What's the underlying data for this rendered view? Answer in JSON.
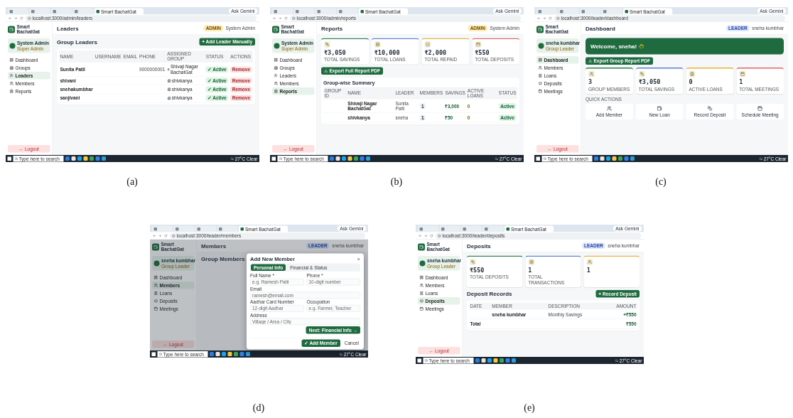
{
  "panels": [
    {
      "caption": "(a)",
      "browser": {
        "tabs": [
          {
            "selected": false
          },
          {
            "selected": false
          },
          {
            "selected": false
          },
          {
            "selected": false
          },
          {
            "title": "Smart BachatGat",
            "selected": true
          }
        ],
        "gemini": "Ask Gemini",
        "url": "localhost:3000/admin/leaders"
      },
      "sidebar": {
        "brand": "Smart BachatGat",
        "user": {
          "name": "System Admin",
          "role": "Super Admin"
        },
        "items": [
          {
            "label": "Dashboard",
            "kind": "dashboard",
            "selected": false
          },
          {
            "label": "Groups",
            "kind": "groups",
            "selected": false
          },
          {
            "label": "Leaders",
            "kind": "leaders",
            "selected": true
          },
          {
            "label": "Members",
            "kind": "members",
            "selected": false
          },
          {
            "label": "Reports",
            "kind": "reports",
            "selected": false
          }
        ],
        "logout": "← Logout"
      },
      "header": {
        "title": "Leaders",
        "badge": {
          "label": "ADMIN",
          "kind": "admin"
        },
        "user": "System Admin"
      },
      "blocks": [
        {
          "kind": "section-head",
          "title": "Group Leaders",
          "button": "+ Add Leader Manually"
        },
        {
          "kind": "table-card",
          "columns": [
            {
              "label": "NAME",
              "kind": "name"
            },
            {
              "label": "USERNAME",
              "kind": "muted"
            },
            {
              "label": "EMAIL",
              "kind": "muted"
            },
            {
              "label": "PHONE",
              "kind": "muted"
            },
            {
              "label": "ASSIGNED GROUP",
              "kind": "group"
            },
            {
              "label": "STATUS",
              "kind": "status"
            },
            {
              "label": "ACTIONS",
              "kind": "action"
            }
          ],
          "rows": [
            [
              "Sunita Patil",
              null,
              null,
              "9000000001",
              "Shivaji Nagar BachatGat",
              "✓ Active",
              "Remove"
            ],
            [
              "shivani",
              null,
              null,
              null,
              "shivkanya",
              "✓ Active",
              "Remove"
            ],
            [
              "snehakumbhar",
              null,
              null,
              null,
              "shivkanya",
              "✓ Active",
              "Remove"
            ],
            [
              "sanjivani",
              null,
              null,
              null,
              "shivkanya",
              "✓ Active",
              "Remove"
            ]
          ]
        }
      ],
      "taskbar": {
        "search": "Type here to search",
        "weather": "27°C Clear"
      }
    },
    {
      "caption": "(b)",
      "browser": {
        "tabs": [
          {
            "selected": false
          },
          {
            "selected": false
          },
          {
            "selected": false
          },
          {
            "selected": false
          },
          {
            "title": "Smart BachatGat",
            "selected": true
          }
        ],
        "gemini": "Ask Gemini",
        "url": "localhost:3000/admin/reports"
      },
      "sidebar": {
        "brand": "Smart BachatGat",
        "user": {
          "name": "System Admin",
          "role": "Super Admin"
        },
        "items": [
          {
            "label": "Dashboard",
            "kind": "dashboard",
            "selected": false
          },
          {
            "label": "Groups",
            "kind": "groups",
            "selected": false
          },
          {
            "label": "Leaders",
            "kind": "leaders",
            "selected": false
          },
          {
            "label": "Members",
            "kind": "members",
            "selected": false
          },
          {
            "label": "Reports",
            "kind": "reports",
            "selected": true
          }
        ],
        "logout": "← Logout"
      },
      "header": {
        "title": "Reports",
        "badge": {
          "label": "ADMIN",
          "kind": "admin"
        },
        "user": "System Admin"
      },
      "blocks": [
        {
          "kind": "stats",
          "items": [
            {
              "value": "₹3,050",
              "label": "TOTAL SAVINGS",
              "kind": "coins",
              "color": "#2e7d4f"
            },
            {
              "value": "₹10,000",
              "label": "TOTAL LOANS",
              "kind": "document",
              "color": "#5b7fd6"
            },
            {
              "value": "₹2,000",
              "label": "TOTAL REPAID",
              "kind": "check",
              "color": "#e6b23a"
            },
            {
              "value": "₹550",
              "label": "TOTAL DEPOSITS",
              "kind": "calendar",
              "color": "#e06666"
            }
          ]
        },
        {
          "kind": "export",
          "button": "Export Full Report PDF"
        },
        {
          "kind": "table-card",
          "title": "Group-wise Summary",
          "columns": [
            {
              "label": "GROUP ID",
              "kind": "muted"
            },
            {
              "label": "NAME",
              "kind": "name"
            },
            {
              "label": "LEADER",
              "kind": "muted"
            },
            {
              "label": "MEMBERS",
              "kind": "count"
            },
            {
              "label": "SAVINGS",
              "kind": "money"
            },
            {
              "label": "ACTIVE LOANS",
              "kind": "warn"
            },
            {
              "label": "STATUS",
              "kind": "status"
            }
          ],
          "rows": [
            [
              null,
              "Shivaji Nagar BachatGat",
              "Sunita Patil",
              "1",
              "₹3,000",
              "0",
              "Active"
            ],
            [
              null,
              "shivkanya",
              "sneha",
              "1",
              "₹50",
              "0",
              "Active"
            ]
          ]
        }
      ],
      "taskbar": {
        "search": "Type here to search",
        "weather": "27°C Clear"
      }
    },
    {
      "caption": "(c)",
      "browser": {
        "tabs": [
          {
            "selected": false
          },
          {
            "selected": false
          },
          {
            "selected": false
          },
          {
            "selected": false
          },
          {
            "title": "Smart BachatGat",
            "selected": true
          }
        ],
        "gemini": "Ask Gemini",
        "url": "localhost:3000/leader/dashboard"
      },
      "sidebar": {
        "brand": "Smart BachatGat",
        "user": {
          "name": "sneha kumbhar",
          "role": "Group Leader"
        },
        "items": [
          {
            "label": "Dashboard",
            "kind": "dashboard",
            "selected": true
          },
          {
            "label": "Members",
            "kind": "members",
            "selected": false
          },
          {
            "label": "Loans",
            "kind": "loans",
            "selected": false
          },
          {
            "label": "Deposits",
            "kind": "deposits",
            "selected": false
          },
          {
            "label": "Meetings",
            "kind": "meetings",
            "selected": false
          }
        ],
        "logout": "← Logout"
      },
      "header": {
        "title": "Dashboard",
        "badge": {
          "label": "LEADER",
          "kind": "leader"
        },
        "user": "sneha kumbhar"
      },
      "blocks": [
        {
          "kind": "banner",
          "title": "Welcome, sneha!"
        },
        {
          "kind": "export",
          "button": "Export Group Report PDF"
        },
        {
          "kind": "stats",
          "items": [
            {
              "value": "3",
              "label": "GROUP MEMBERS",
              "kind": "users",
              "color": "#2e7d4f"
            },
            {
              "value": "₹3,050",
              "label": "TOTAL SAVINGS",
              "kind": "coins",
              "color": "#5b7fd6"
            },
            {
              "value": "0",
              "label": "ACTIVE LOANS",
              "kind": "document",
              "color": "#e6b23a"
            },
            {
              "value": "1",
              "label": "TOTAL MEETINGS",
              "kind": "calendar",
              "color": "#e06666"
            }
          ]
        },
        {
          "kind": "quick-actions",
          "label": "QUICK ACTIONS",
          "items": [
            {
              "label": "Add Member",
              "kind": "users"
            },
            {
              "label": "New Loan",
              "kind": "loan"
            },
            {
              "label": "Record Deposit",
              "kind": "coins"
            },
            {
              "label": "Schedule Meeting",
              "kind": "calendar"
            }
          ]
        }
      ],
      "taskbar": {
        "search": "Type here to search",
        "weather": "27°C Clear"
      }
    },
    {
      "caption": "(d)",
      "browser": {
        "tabs": [
          {
            "selected": false
          },
          {
            "selected": false
          },
          {
            "selected": false
          },
          {
            "selected": false
          },
          {
            "title": "Smart BachatGat",
            "selected": true
          }
        ],
        "gemini": "Ask Gemini",
        "url": "localhost:3000/leader/members"
      },
      "sidebar": {
        "brand": "Smart BachatGat",
        "user": {
          "name": "sneha kumbhar",
          "role": "Group Leader"
        },
        "items": [
          {
            "label": "Dashboard",
            "kind": "dashboard",
            "selected": false
          },
          {
            "label": "Members",
            "kind": "members",
            "selected": true
          },
          {
            "label": "Loans",
            "kind": "loans",
            "selected": false
          },
          {
            "label": "Deposits",
            "kind": "deposits",
            "selected": false
          },
          {
            "label": "Meetings",
            "kind": "meetings",
            "selected": false
          }
        ],
        "logout": "← Logout"
      },
      "header": {
        "title": "Members",
        "badge": {
          "label": "LEADER",
          "kind": "leader"
        },
        "user": "sneha kumbhar"
      },
      "blocks": [
        {
          "kind": "section-head",
          "title": "Group Members"
        }
      ],
      "modal": {
        "title": "Add New Member",
        "close": "×",
        "tabs": [
          {
            "label": "Personal Info",
            "selected": true
          },
          {
            "label": "Financial & Status",
            "selected": false
          }
        ],
        "fields": [
          {
            "label": "Full Name *",
            "placeholder": "e.g. Ramesh Patil",
            "wide": false
          },
          {
            "label": "Phone *",
            "placeholder": "10-digit number",
            "wide": false
          },
          {
            "label": "Email",
            "placeholder": "ramesh@email.com",
            "wide": true
          },
          {
            "label": "Aadhar Card Number",
            "placeholder": "12-digit Aadhar",
            "wide": false
          },
          {
            "label": "Occupation",
            "placeholder": "e.g. Farmer, Teacher",
            "wide": false
          },
          {
            "label": "Address",
            "placeholder": "Village / Area / City",
            "wide": true
          }
        ],
        "next": "Next: Financial Info →",
        "submit": "✓ Add Member",
        "cancel": "Cancel"
      },
      "taskbar": {
        "search": "Type here to search",
        "weather": "27°C Clear"
      }
    },
    {
      "caption": "(e)",
      "browser": {
        "tabs": [
          {
            "selected": false
          },
          {
            "selected": false
          },
          {
            "selected": false
          },
          {
            "selected": false
          },
          {
            "title": "Smart BachatGat",
            "selected": true
          }
        ],
        "gemini": "Ask Gemini",
        "url": "localhost:3000/leader/deposits"
      },
      "sidebar": {
        "brand": "Smart BachatGat",
        "user": {
          "name": "sneha kumbhar",
          "role": "Group Leader"
        },
        "items": [
          {
            "label": "Dashboard",
            "kind": "dashboard",
            "selected": false
          },
          {
            "label": "Members",
            "kind": "members",
            "selected": false
          },
          {
            "label": "Loans",
            "kind": "loans",
            "selected": false
          },
          {
            "label": "Deposits",
            "kind": "deposits",
            "selected": true
          },
          {
            "label": "Meetings",
            "kind": "meetings",
            "selected": false
          }
        ],
        "logout": "← Logout"
      },
      "header": {
        "title": "Deposits",
        "badge": {
          "label": "LEADER",
          "kind": "leader"
        },
        "user": "sneha kumbhar"
      },
      "blocks": [
        {
          "kind": "stats",
          "items": [
            {
              "value": "₹550",
              "label": "TOTAL DEPOSITS",
              "kind": "coins",
              "color": "#2e7d4f"
            },
            {
              "value": "1",
              "label": "TOTAL TRANSACTIONS",
              "kind": "document",
              "color": "#5b7fd6"
            },
            {
              "value": "1",
              "kind": "users",
              "color": "#e6b23a"
            }
          ]
        },
        {
          "kind": "section-head",
          "title": "Deposit Records",
          "button": "+ Record Deposit"
        },
        {
          "kind": "table-card",
          "columns": [
            {
              "label": "DATE",
              "kind": "muted"
            },
            {
              "label": "MEMBER",
              "kind": "name"
            },
            {
              "label": "DESCRIPTION",
              "kind": "muted"
            },
            {
              "label": "AMOUNT",
              "kind": "amount"
            }
          ],
          "rows": [
            [
              null,
              "sneha kumbhar",
              "Monthly Savings",
              "+₹550"
            ]
          ],
          "total": {
            "label": "Total",
            "value": "₹550"
          }
        }
      ],
      "taskbar": {
        "search": "Type here to search",
        "weather": "27°C Clear"
      }
    }
  ]
}
